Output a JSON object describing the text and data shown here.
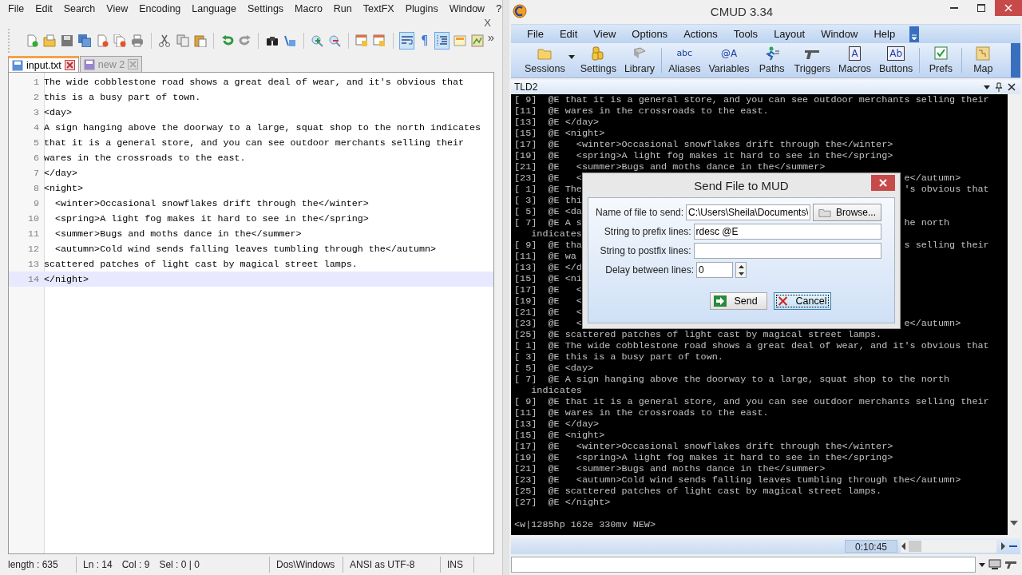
{
  "editor": {
    "menu": [
      "File",
      "Edit",
      "Search",
      "View",
      "Encoding",
      "Language",
      "Settings",
      "Macro",
      "Run",
      "TextFX",
      "Plugins",
      "Window",
      "?"
    ],
    "close_doc": "X",
    "toolbar": [
      {
        "kind": "button",
        "pressed": false
      },
      {
        "kind": "button",
        "pressed": false
      },
      {
        "kind": "button",
        "pressed": false
      },
      {
        "kind": "button",
        "pressed": false
      },
      {
        "kind": "button",
        "pressed": false
      },
      {
        "kind": "button",
        "pressed": false
      },
      {
        "kind": "button",
        "pressed": false
      },
      {
        "kind": "separator"
      },
      {
        "kind": "button",
        "pressed": false
      },
      {
        "kind": "button",
        "pressed": false
      },
      {
        "kind": "button",
        "pressed": false
      },
      {
        "kind": "separator"
      },
      {
        "kind": "button",
        "pressed": false
      },
      {
        "kind": "button",
        "pressed": false
      },
      {
        "kind": "separator"
      },
      {
        "kind": "button",
        "pressed": false
      },
      {
        "kind": "button",
        "pressed": false
      },
      {
        "kind": "separator"
      },
      {
        "kind": "button",
        "pressed": false
      },
      {
        "kind": "button",
        "pressed": false
      },
      {
        "kind": "separator"
      },
      {
        "kind": "button",
        "pressed": false
      },
      {
        "kind": "button",
        "pressed": false
      },
      {
        "kind": "separator"
      },
      {
        "kind": "button",
        "pressed": true
      },
      {
        "kind": "glyph",
        "text": "¶",
        "pressed": false
      },
      {
        "kind": "button",
        "pressed": true
      },
      {
        "kind": "button",
        "pressed": false
      },
      {
        "kind": "button",
        "pressed": false
      }
    ],
    "toolbar_overflow": "»",
    "tabs": [
      {
        "label": "input.txt",
        "selected": true
      },
      {
        "label": "new  2",
        "selected": false
      }
    ],
    "lines": [
      {
        "number": "1",
        "text": "The wide cobblestone road shows a great deal of wear, and it's obvious that",
        "current": false
      },
      {
        "number": "2",
        "text": "this is a busy part of town.",
        "current": false
      },
      {
        "number": "3",
        "text": "<day>",
        "current": false
      },
      {
        "number": "4",
        "text": "A sign hanging above the doorway to a large, squat shop to the north indicates",
        "current": false
      },
      {
        "number": "5",
        "text": "that it is a general store, and you can see outdoor merchants selling their",
        "current": false
      },
      {
        "number": "6",
        "text": "wares in the crossroads to the east.",
        "current": false
      },
      {
        "number": "7",
        "text": "</day>",
        "current": false
      },
      {
        "number": "8",
        "text": "<night>",
        "current": false
      },
      {
        "number": "9",
        "text": "  <winter>Occasional snowflakes drift through the</winter>",
        "current": false
      },
      {
        "number": "10",
        "text": "  <spring>A light fog makes it hard to see in the</spring>",
        "current": false
      },
      {
        "number": "11",
        "text": "  <summer>Bugs and moths dance in the</summer>",
        "current": false
      },
      {
        "number": "12",
        "text": "  <autumn>Cold wind sends falling leaves tumbling through the</autumn>",
        "current": false
      },
      {
        "number": "13",
        "text": "scattered patches of light cast by magical street lamps.",
        "current": false
      },
      {
        "number": "14",
        "text": "</night>",
        "current": true
      }
    ],
    "status": [
      [
        "length : 635"
      ],
      [
        "Ln : 14",
        "Col : 9",
        "Sel : 0 | 0"
      ],
      [
        "Dos\\Windows"
      ],
      [
        "ANSI as UTF-8"
      ],
      [
        "INS"
      ]
    ]
  },
  "cmud": {
    "title": "CMUD 3.34",
    "menu": [
      "File",
      "Edit",
      "View",
      "Options",
      "Actions",
      "Tools",
      "Layout",
      "Window",
      "Help"
    ],
    "toolbar": [
      {
        "kind": "button",
        "label": "Sessions",
        "has_menu": true
      },
      {
        "kind": "button",
        "label": "Settings",
        "has_menu": false
      },
      {
        "kind": "button",
        "label": "Library",
        "has_menu": false
      },
      {
        "kind": "separator"
      },
      {
        "kind": "button",
        "label": "Aliases",
        "icon_text": "abc",
        "has_menu": false
      },
      {
        "kind": "button",
        "label": "Variables",
        "icon_text": "@A",
        "has_menu": false
      },
      {
        "kind": "button",
        "label": "Paths",
        "has_menu": false
      },
      {
        "kind": "button",
        "label": "Triggers",
        "has_menu": false
      },
      {
        "kind": "button",
        "label": "Macros",
        "icon_text": "A",
        "has_menu": false
      },
      {
        "kind": "button",
        "label": "Buttons",
        "icon_text": "Ab",
        "has_menu": false
      },
      {
        "kind": "separator"
      },
      {
        "kind": "button",
        "label": "Prefs",
        "has_menu": false
      },
      {
        "kind": "separator"
      },
      {
        "kind": "button",
        "label": "Map",
        "has_menu": false
      }
    ],
    "panel_title": "TLD2",
    "terminal": [
      {
        "text": "[ 9]  @E that it is a general store, and you can see outdoor merchants selling their"
      },
      {
        "text": "[11]  @E wares in the crossroads to the east."
      },
      {
        "text": "[13]  @E </day>"
      },
      {
        "text": "[15]  @E <night>"
      },
      {
        "text": "[17]  @E   <winter>Occasional snowflakes drift through the</winter>"
      },
      {
        "text": "[19]  @E   <spring>A light fog makes it hard to see in the</spring>"
      },
      {
        "text": "[21]  @E   <summer>Bugs and moths dance in the</summer>"
      },
      {
        "text": "[23]  @E   <",
        "right": "e</autumn>"
      },
      {
        "text": "[ 1]  @E The",
        "right": "'s obvious that"
      },
      {
        "text": "[ 3]  @E thi"
      },
      {
        "text": "[ 5]  @E <da"
      },
      {
        "text": "[ 7]  @E A s",
        "right": "he north"
      },
      {
        "text": "   indicates"
      },
      {
        "text": "[ 9]  @E tha",
        "right": "s selling their"
      },
      {
        "text": "[11]  @E wa"
      },
      {
        "text": "[13]  @E </d"
      },
      {
        "text": "[15]  @E <ni"
      },
      {
        "text": "[17]  @E   <"
      },
      {
        "text": "[19]  @E   <"
      },
      {
        "text": "[21]  @E   <"
      },
      {
        "text": "[23]  @E   <",
        "right": "e</autumn>"
      },
      {
        "text": "[25]  @E scattered patches of light cast by magical street lamps."
      },
      {
        "text": "[ 1]  @E The wide cobblestone road shows a great deal of wear, and it's obvious that"
      },
      {
        "text": "[ 3]  @E this is a busy part of town."
      },
      {
        "text": "[ 5]  @E <day>"
      },
      {
        "text": "[ 7]  @E A sign hanging above the doorway to a large, squat shop to the north"
      },
      {
        "text": "   indicates"
      },
      {
        "text": "[ 9]  @E that it is a general store, and you can see outdoor merchants selling their"
      },
      {
        "text": "[11]  @E wares in the crossroads to the east."
      },
      {
        "text": "[13]  @E </day>"
      },
      {
        "text": "[15]  @E <night>"
      },
      {
        "text": "[17]  @E   <winter>Occasional snowflakes drift through the</winter>"
      },
      {
        "text": "[19]  @E   <spring>A light fog makes it hard to see in the</spring>"
      },
      {
        "text": "[21]  @E   <summer>Bugs and moths dance in the</summer>"
      },
      {
        "text": "[23]  @E   <autumn>Cold wind sends falling leaves tumbling through the</autumn>"
      },
      {
        "text": "[25]  @E scattered patches of light cast by magical street lamps."
      },
      {
        "text": "[27]  @E </night>"
      }
    ],
    "prompt": "<w|1285hp 162e 330mv NEW>",
    "timer": "0:10:45"
  },
  "dialog": {
    "title": "Send File to MUD",
    "fields": [
      {
        "label": "Name of file to send:",
        "value": "C:\\Users\\Sheila\\Documents\\",
        "kind": "file",
        "button": "Browse..."
      },
      {
        "label": "String to prefix lines:",
        "value": "rdesc @E",
        "kind": "text"
      },
      {
        "label": "String to postfix lines:",
        "kind": "text"
      },
      {
        "label": "Delay between lines:",
        "value": "0",
        "kind": "spin"
      }
    ],
    "buttons": [
      {
        "label": "Send",
        "kind": "send",
        "focused": false
      },
      {
        "label": "Cancel",
        "kind": "cancel",
        "focused": true
      }
    ]
  }
}
